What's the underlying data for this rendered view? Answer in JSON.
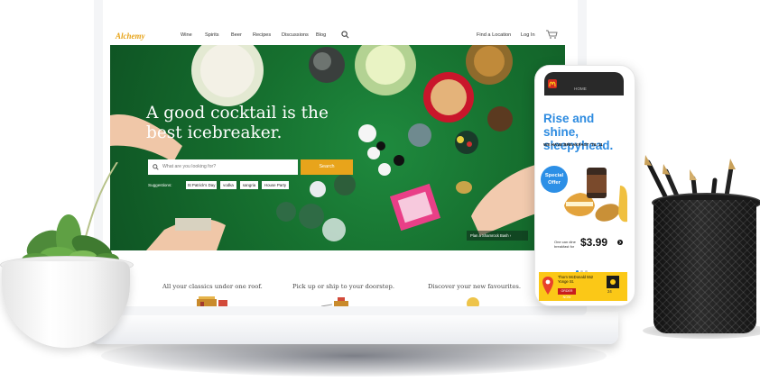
{
  "site": {
    "logo": "Alchemy",
    "nav": {
      "links": [
        "Wine",
        "Spirits",
        "Beer",
        "Recipes",
        "Discussions",
        "Blog"
      ],
      "right_links": [
        "Find a Location",
        "Log In"
      ]
    },
    "hero": {
      "title": "A good cocktail is the best icebreaker.",
      "search_placeholder": "What are you looking for?",
      "search_button": "Search",
      "suggestions_label": "Suggestions:",
      "suggestions": [
        "St Patrick's Day",
        "vodka",
        "sangria",
        "House Party"
      ],
      "story_link": "Plan a Shamrock Bash"
    },
    "sections": [
      "All your classics under one roof.",
      "Pick up or ship to your doorstep.",
      "Discover your new favourites."
    ]
  },
  "phone": {
    "header": "HOME",
    "headline": "Rise and shine, sleepyhead.",
    "subhead": "WE HAVE BREAKFAST 'TIL 11",
    "badge": "Special Offer",
    "one_can_dine": "One can dine breakfast for",
    "price": "$3.99",
    "delivery": "Thorn McDonald 552 Yonge St.",
    "order_button": "ORDER NOW",
    "hours": "24"
  },
  "colors": {
    "brand": "#e7a318",
    "hero_green": "#16702f",
    "search_button": "#e8a41b",
    "phone_blue": "#2d8be0",
    "mcd_yellow": "#fbc817",
    "mcd_red": "#c81d1d"
  }
}
